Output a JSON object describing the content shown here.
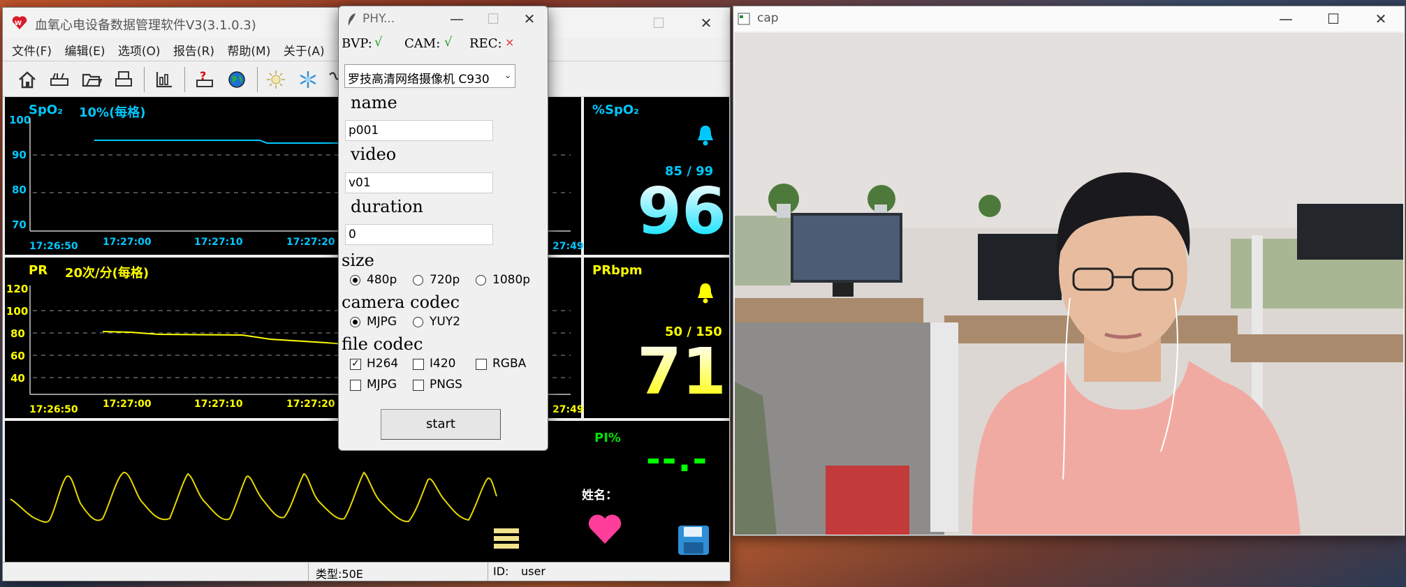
{
  "main": {
    "title": "血氧心电设备数据管理软件V3(3.1.0.3)",
    "menu": [
      "文件(F)",
      "编辑(E)",
      "选项(O)",
      "报告(R)",
      "帮助(M)",
      "关于(A)"
    ],
    "spo2_panel": {
      "label": "SpO₂",
      "scale": "10%(每格)",
      "y_ticks": [
        "100",
        "90",
        "80",
        "70"
      ],
      "x_ticks": [
        "17:27:00",
        "17:27:10",
        "17:27:20"
      ],
      "start": "17:26:50",
      "end": "27:49"
    },
    "pr_panel": {
      "label": "PR",
      "scale": "20次/分(每格)",
      "y_ticks": [
        "120",
        "100",
        "80",
        "60",
        "40"
      ],
      "x_ticks": [
        "17:27:00",
        "17:27:10",
        "17:27:20"
      ],
      "start": "17:26:50",
      "end": "27:49"
    },
    "spo2_value": {
      "label": "%SpO₂",
      "range": "85 / 99",
      "value": "96"
    },
    "pr_value": {
      "label": "PRbpm",
      "range": "50 / 150",
      "value": "71"
    },
    "pi": {
      "label": "PI%",
      "value": "--.-"
    },
    "name_label": "姓名：",
    "status": {
      "type": "类型:50E",
      "id": "ID:",
      "user": "user"
    }
  },
  "phy": {
    "title": "PHY...",
    "bvp": "BVP:",
    "bvp_mark": "√",
    "cam": "CAM:",
    "cam_mark": "√",
    "rec": "REC:",
    "rec_mark": "×",
    "camera_select": "罗技高清网络摄像机 C930",
    "name_label": "name",
    "name_value": "p001",
    "video_label": "video",
    "video_value": "v01",
    "duration_label": "duration",
    "duration_value": "0",
    "size_label": "size",
    "sizes": [
      "480p",
      "720p",
      "1080p"
    ],
    "camera_codec_label": "camera codec",
    "camera_codecs": [
      "MJPG",
      "YUY2"
    ],
    "file_codec_label": "file codec",
    "file_codecs": [
      "H264",
      "I420",
      "RGBA",
      "MJPG",
      "PNGS"
    ],
    "start_label": "start"
  },
  "cap": {
    "title": "cap"
  },
  "colors": {
    "spo2": "#00c8ff",
    "pr": "#ffff00",
    "pi": "#00ff00",
    "rec_x": "#e03030",
    "check": "#2a9d2a"
  }
}
